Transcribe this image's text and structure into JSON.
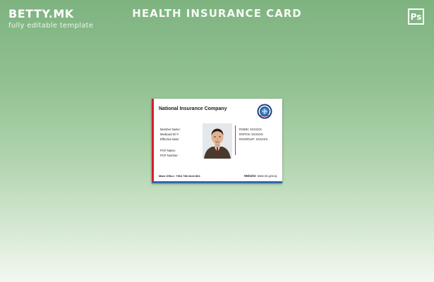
{
  "header": {
    "brand": "BETTY.MK",
    "tagline": "fully editable template",
    "title": "HEALTH INSURANCE CARD",
    "ps_label": "Ps"
  },
  "card": {
    "company": "National Insurance Company",
    "left_fields": [
      "Member Name:",
      "Medicaid ID #:",
      "Effective Date:",
      "PCP Name:",
      "PCP Number:"
    ],
    "right_fields": [
      "RXBIN: XXXXXX",
      "RXPCN: XXXXXX",
      "RXGROUP: XXXXXX"
    ],
    "footer_left": "Main Office: +964 788 4444 864",
    "footer_right_label": "Website:",
    "footer_right_value": "www.nic.gov.iq"
  },
  "colors": {
    "accent_red": "#d81c2c",
    "accent_blue": "#2d6aa8",
    "background_top": "#7eb380",
    "background_bottom": "#f3f8f1"
  },
  "icons": {
    "photoshop": "ps-icon",
    "seal": "seal-icon",
    "photo": "member-photo"
  }
}
